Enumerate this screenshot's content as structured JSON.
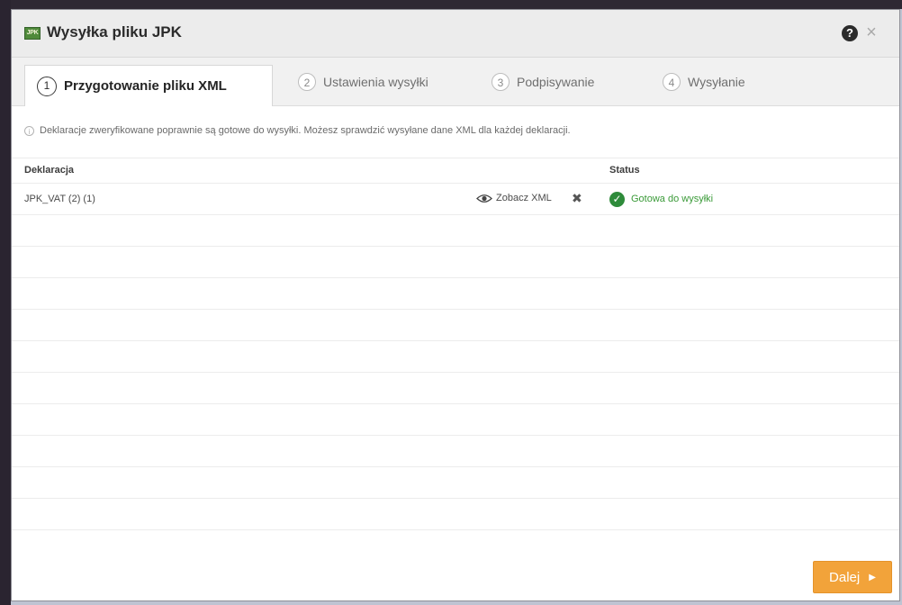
{
  "dialog": {
    "title": "Wysyłka pliku JPK",
    "app_icon": {
      "name": "jpk-logo-icon",
      "text": "JPK"
    },
    "help_icon": "question-circle-icon",
    "close_icon": "close-icon"
  },
  "tabs": [
    {
      "number": "1",
      "label": "Przygotowanie pliku XML",
      "active": true
    },
    {
      "number": "2",
      "label": "Ustawienia wysyłki",
      "active": false
    },
    {
      "number": "3",
      "label": "Podpisywanie",
      "active": false
    },
    {
      "number": "4",
      "label": "Wysyłanie",
      "active": false
    }
  ],
  "info_text": "Deklaracje zweryfikowane poprawnie są gotowe do wysyłki. Możesz sprawdzić wysyłane dane XML dla każdej deklaracji.",
  "table": {
    "headers": {
      "declaration": "Deklaracja",
      "status": "Status"
    },
    "rows": [
      {
        "declaration": "JPK_VAT (2) (1)",
        "view_xml_label": "Zobacz XML",
        "status": "Gotowa do wysyłki"
      }
    ]
  },
  "footer": {
    "next_label": "Dalej"
  },
  "colors": {
    "accent": "#f2a33a",
    "status_ok": "#2e8b3a",
    "status_text": "#3a9a38"
  }
}
